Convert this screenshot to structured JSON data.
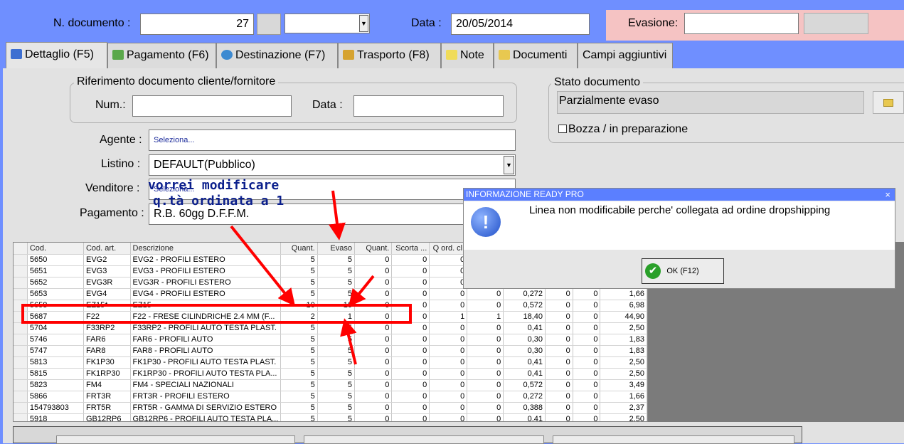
{
  "header": {
    "ndoc_label": "N. documento :",
    "ndoc_value": "27",
    "data_label": "Data :",
    "data_value": "20/05/2014",
    "evasione_label": "Evasione:",
    "evasione_value": ""
  },
  "tabs": [
    {
      "label": "Dettaglio (F5)",
      "active": true
    },
    {
      "label": "Pagamento (F6)"
    },
    {
      "label": "Destinazione (F7)"
    },
    {
      "label": "Trasporto (F8)"
    },
    {
      "label": "Note"
    },
    {
      "label": "Documenti"
    },
    {
      "label": "Campi aggiuntivi"
    }
  ],
  "rif": {
    "title": "Riferimento documento cliente/fornitore",
    "num_label": "Num.:",
    "num_value": "",
    "data_label": "Data :",
    "data_value": ""
  },
  "form": {
    "agente_label": "Agente :",
    "agente_value": "Seleziona...",
    "listino_label": "Listino :",
    "listino_value": "DEFAULT(Pubblico)",
    "venditore_label": "Venditore :",
    "venditore_value": "Seleziona...",
    "pagamento_label": "Pagamento :",
    "pagamento_value": "R.B. 60gg D.F.F.M."
  },
  "stato": {
    "title": "Stato documento",
    "value": "Parzialmente evaso",
    "bozza_label": "Bozza / in preparazione"
  },
  "annotation": {
    "line1": "vorrei modificare",
    "line2": "q.tà ordinata a 1"
  },
  "grid": {
    "headers": [
      "",
      "Cod.",
      "Cod. art.",
      "Descrizione",
      "Quant.",
      "Evaso",
      "Quant.",
      "Scorta ...",
      "Q ord. cl.",
      "",
      "",
      "",
      "",
      ""
    ],
    "rows": [
      [
        "",
        "5650",
        "EVG2",
        "EVG2 - PROFILI ESTERO",
        "5",
        "5",
        "0",
        "0",
        "0",
        "",
        "",
        "",
        "",
        ""
      ],
      [
        "",
        "5651",
        "EVG3",
        "EVG3 - PROFILI ESTERO",
        "5",
        "5",
        "0",
        "0",
        "0",
        "",
        "",
        "",
        "",
        ""
      ],
      [
        "",
        "5652",
        "EVG3R",
        "EVG3R - PROFILI ESTERO",
        "5",
        "5",
        "0",
        "0",
        "0",
        "",
        "",
        "",
        "",
        ""
      ],
      [
        "",
        "5653",
        "EVG4",
        "EVG4 - PROFILI ESTERO",
        "5",
        "5",
        "0",
        "0",
        "0",
        "0",
        "0,272",
        "0",
        "0",
        "1,66"
      ],
      [
        "",
        "5658",
        "EZ15*",
        "EZ15",
        "10",
        "10",
        "0",
        "0",
        "0",
        "0",
        "0,572",
        "0",
        "0",
        "6,98"
      ],
      [
        "",
        "5687",
        "F22",
        "F22 - FRESE CILINDRICHE 2.4 MM (F...",
        "2",
        "1",
        "0",
        "0",
        "1",
        "1",
        "18,40",
        "0",
        "0",
        "44,90"
      ],
      [
        "",
        "5704",
        "F33RP2",
        "F33RP2 - PROFILI AUTO TESTA PLAST.",
        "5",
        "5",
        "0",
        "0",
        "0",
        "0",
        "0,41",
        "0",
        "0",
        "2,50"
      ],
      [
        "",
        "5746",
        "FAR6",
        "FAR6 - PROFILI AUTO",
        "5",
        "5",
        "0",
        "0",
        "0",
        "0",
        "0,30",
        "0",
        "0",
        "1,83"
      ],
      [
        "",
        "5747",
        "FAR8",
        "FAR8 - PROFILI AUTO",
        "5",
        "5",
        "0",
        "0",
        "0",
        "0",
        "0,30",
        "0",
        "0",
        "1,83"
      ],
      [
        "",
        "5813",
        "FK1P30",
        "FK1P30 - PROFILI AUTO TESTA PLAST.",
        "5",
        "5",
        "0",
        "0",
        "0",
        "0",
        "0,41",
        "0",
        "0",
        "2,50"
      ],
      [
        "",
        "5815",
        "FK1RP30",
        "FK1RP30 - PROFILI AUTO TESTA PLA...",
        "5",
        "5",
        "0",
        "0",
        "0",
        "0",
        "0,41",
        "0",
        "0",
        "2,50"
      ],
      [
        "",
        "5823",
        "FM4",
        "FM4 - SPECIALI NAZIONALI",
        "5",
        "5",
        "0",
        "0",
        "0",
        "0",
        "0,572",
        "0",
        "0",
        "3,49"
      ],
      [
        "",
        "5866",
        "FRT3R",
        "FRT3R - PROFILI ESTERO",
        "5",
        "5",
        "0",
        "0",
        "0",
        "0",
        "0,272",
        "0",
        "0",
        "1,66"
      ],
      [
        "",
        "154793803",
        "FRT5R",
        "FRT5R - GAMMA DI SERVIZIO ESTERO",
        "5",
        "5",
        "0",
        "0",
        "0",
        "0",
        "0,388",
        "0",
        "0",
        "2,37"
      ],
      [
        "",
        "5918",
        "GB12RP6",
        "GB12RP6 - PROFILI AUTO TESTA PLA...",
        "5",
        "5",
        "0",
        "0",
        "0",
        "0",
        "0,41",
        "0",
        "0",
        "2,50"
      ]
    ]
  },
  "dialog": {
    "title": "INFORMAZIONE READY PRO",
    "close": "×",
    "message": "Linea non modificabile perche' collegata ad ordine dropshipping",
    "ok_label": "OK (F12)"
  }
}
